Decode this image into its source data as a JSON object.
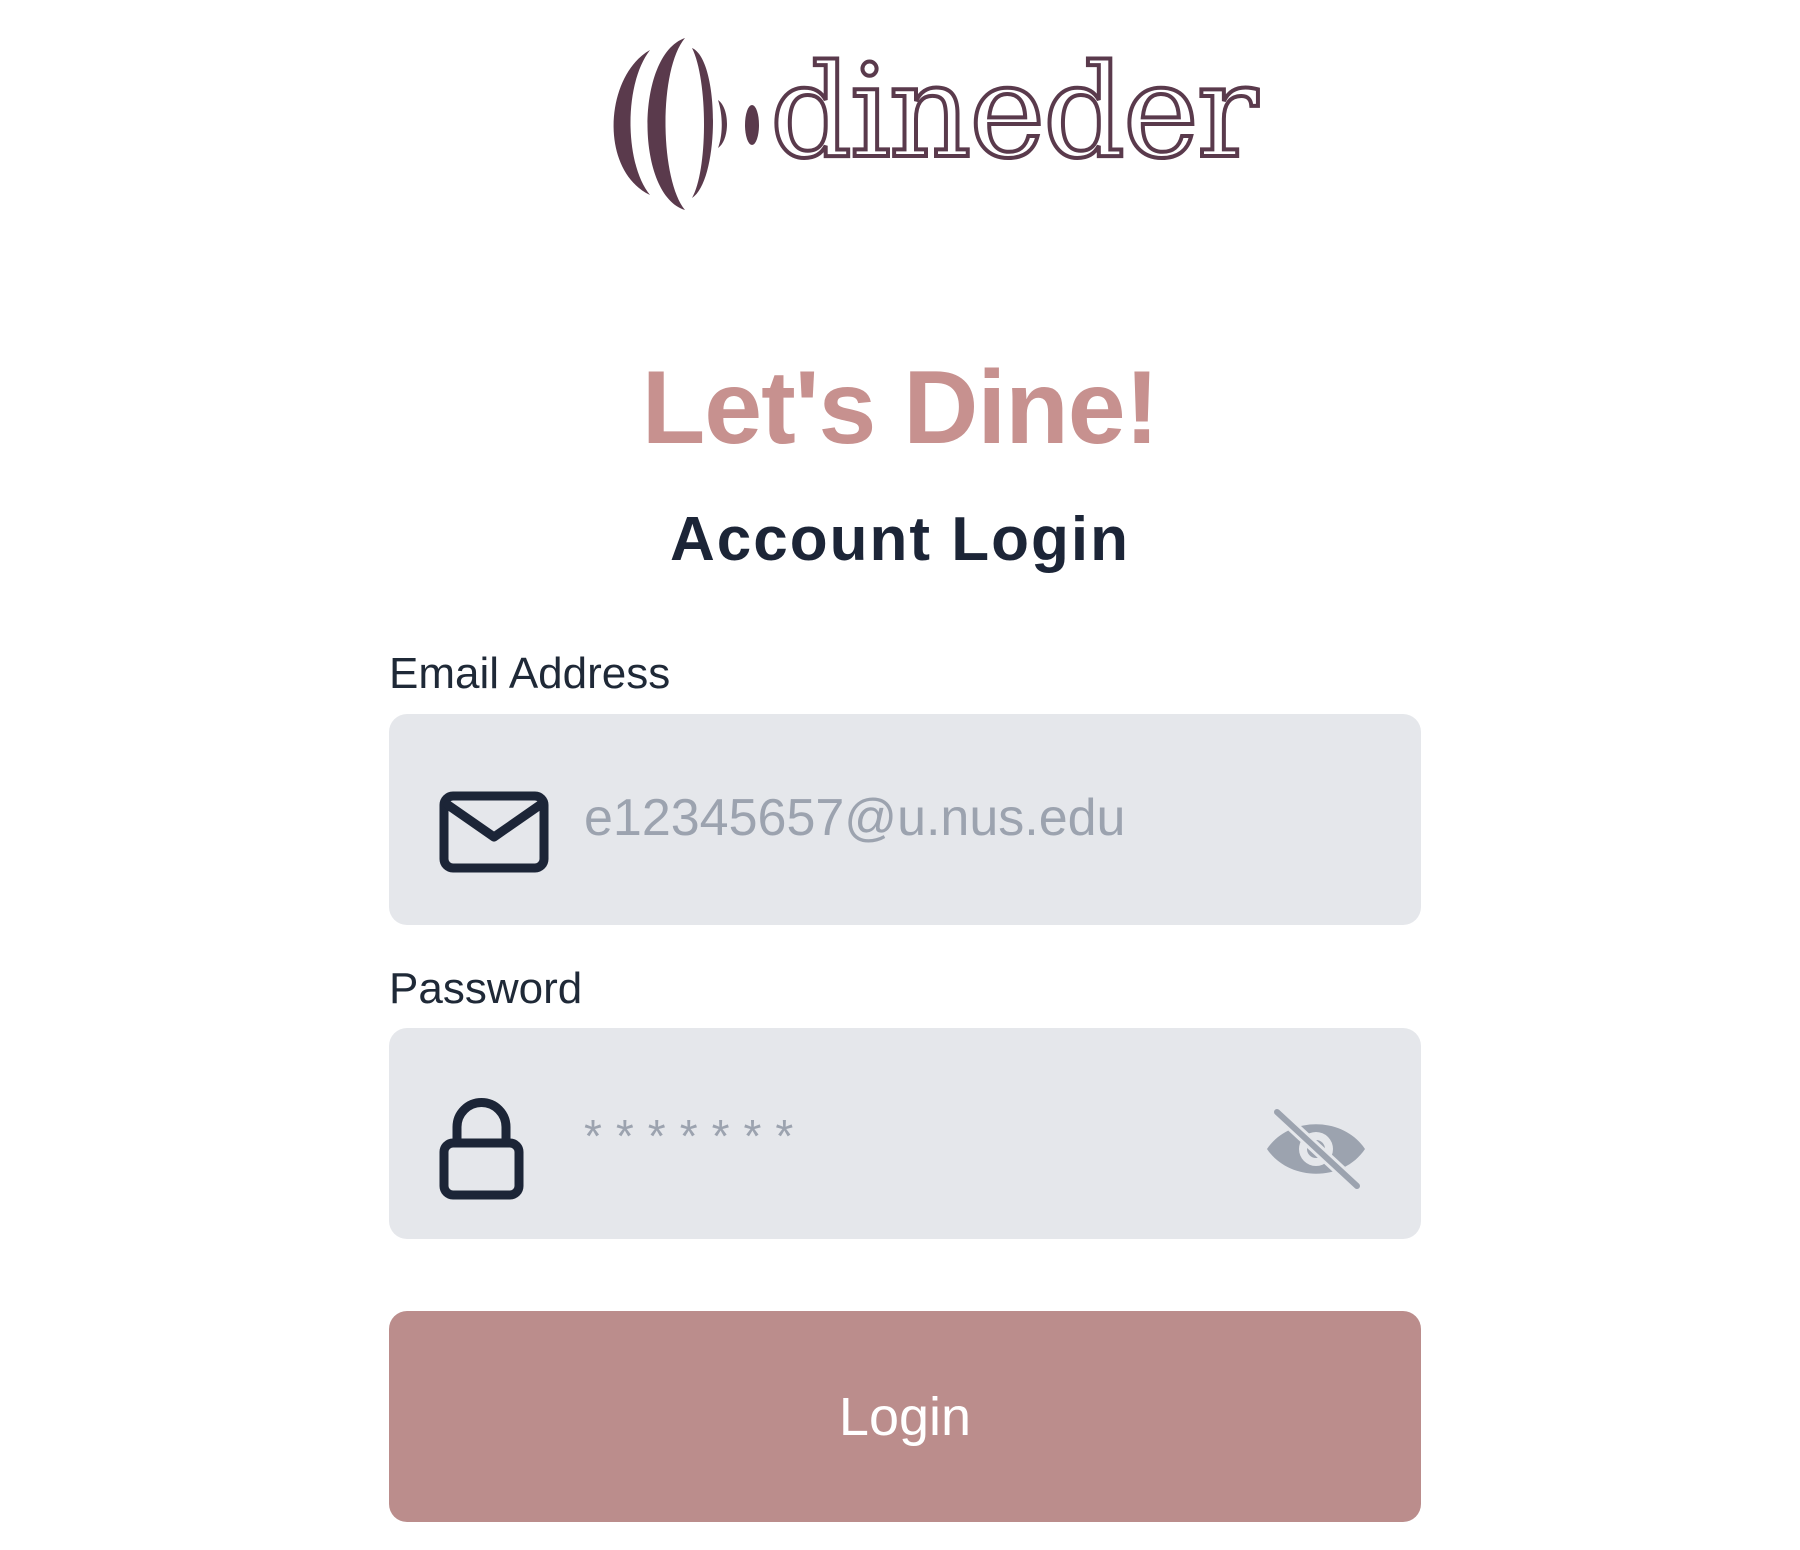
{
  "brand": {
    "name": "dineder",
    "icon": "concentric-arcs-logo",
    "color": "#5a3a4c"
  },
  "headline": "Let's Dine!",
  "subtitle": "Account Login",
  "form": {
    "email": {
      "label": "Email Address",
      "placeholder": "e12345657@u.nus.edu",
      "icon": "mail-icon"
    },
    "password": {
      "label": "Password",
      "placeholder": "*******",
      "icon": "lock-icon",
      "toggle_icon": "eye-off-icon"
    },
    "submit_label": "Login"
  },
  "colors": {
    "accent": "#c7918f",
    "button": "#bb8d8c",
    "field_background": "#e5e7eb",
    "heading": "#1c2537",
    "placeholder": "#9ca3af"
  }
}
